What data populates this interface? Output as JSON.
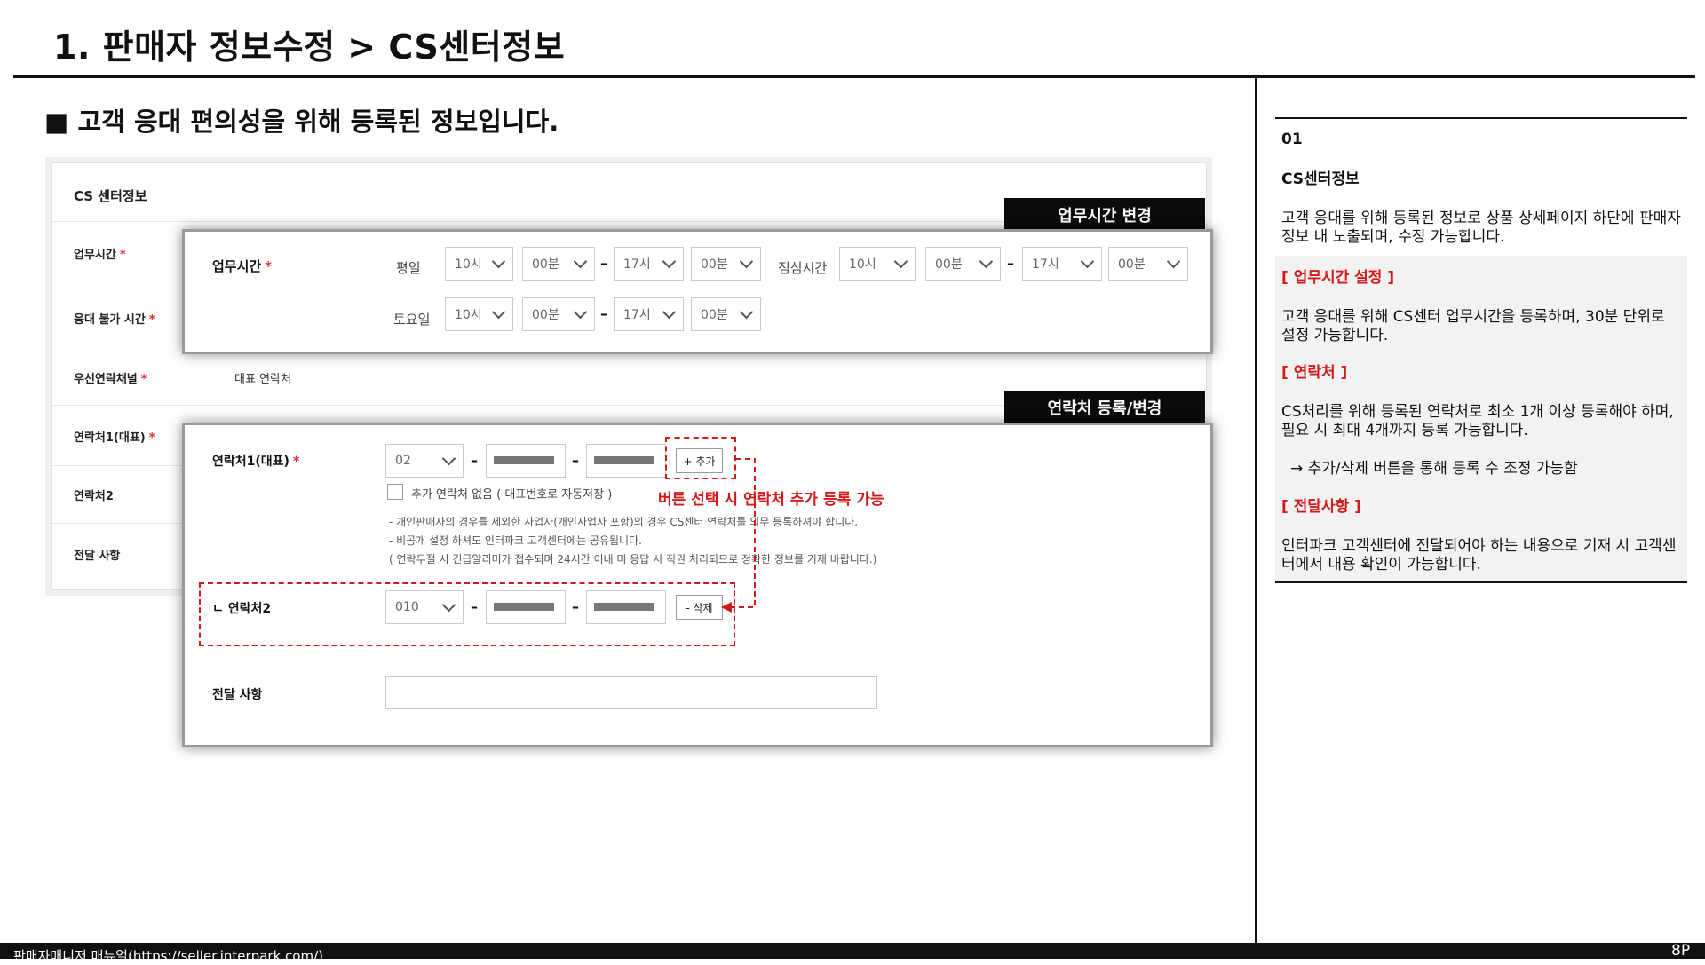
{
  "page": {
    "title": "1. 판매자 정보수정 > CS센터정보",
    "heading": "■ 고객 응대 편의성을 위해 등록된 정보입니다."
  },
  "screenshot": {
    "title": "CS 센터정보",
    "labels": {
      "hours": "업무시간",
      "unavailable": "응대 불가 시간",
      "priority_channel": "우선연락채널",
      "contact1": "연락처1(대표)",
      "contact2": "연락처2",
      "message": "전달 사항"
    },
    "required_mark": "*",
    "priority_channel_value": "대표 연락처"
  },
  "tags": {
    "hours_change": "업무시간 변경",
    "contact_change": "연락처 등록/변경"
  },
  "hours_panel": {
    "label": "업무시간",
    "weekday_label": "평일",
    "saturday_label": "토요일",
    "lunch_label": "점심시간",
    "weekday": [
      "10시",
      "00분",
      "17시",
      "00분"
    ],
    "lunch": [
      "10시",
      "00분",
      "17시",
      "00분"
    ],
    "saturday": [
      "10시",
      "00분",
      "17시",
      "00분"
    ],
    "dash": "–"
  },
  "contact_panel": {
    "contact1_label": "연락처1(대표)",
    "contact1_area": "02",
    "add_button": "+ 추가",
    "no_more_checkbox": "추가 연락처 없음 ( 대표번호로 자동저장 )",
    "annotation": "버튼 선택 시 연락처 추가 등록 가능",
    "notes": [
      "- 개인판매자의 경우를 제외한 사업자(개인사업자 포함)의 경우 CS센터 연락처를 의무 등록하셔야 합니다.",
      "- 비공개 설정 하셔도 인터파크 고객센터에는 공유됩니다.",
      "( 연락두절 시 긴급알리미가 접수되며 24시간 이내 미 응답 시 직권 처리되므로 정확한 정보를 기재 바랍니다.)"
    ],
    "contact2_label": "ㄴ 연락처2",
    "contact2_area": "010",
    "delete_button": "- 삭제",
    "message_label": "전달 사항"
  },
  "right_panel": {
    "number": "01",
    "title": "CS센터정보",
    "intro": "고객 응대를 위해 등록된 정보로 상품 상세페이지 하단에 판매자 정보 내 노출되며, 수정 가능합니다.",
    "hours_heading": "[ 업무시간 설정 ]",
    "hours_text": "고객 응대를 위해 CS센터 업무시간을 등록하며, 30분 단위로 설정 가능합니다.",
    "contact_heading": "[ 연락처 ]",
    "contact_text": "CS처리를 위해 등록된 연락처로 최소 1개 이상 등록해야 하며, 필요 시 최대 4개까지 등록 가능합니다.",
    "contact_arrow_text": "→ 추가/삭제 버튼을 통해 등록 수 조정 가능함",
    "message_heading": "[ 전달사항 ]",
    "message_text": "인터파크 고객센터에 전달되어야 하는 내용으로 기재 시 고객센터에서 내용 확인이 가능합니다."
  },
  "footer": {
    "text": "판매자매니저 매뉴얼(https://seller.interpark.com/)",
    "page": "8P"
  },
  "colors": {
    "accent_red": "#d31a1a",
    "required_red": "#e0233a",
    "tag_black": "#0b0b0b",
    "footer_black": "#111111"
  }
}
